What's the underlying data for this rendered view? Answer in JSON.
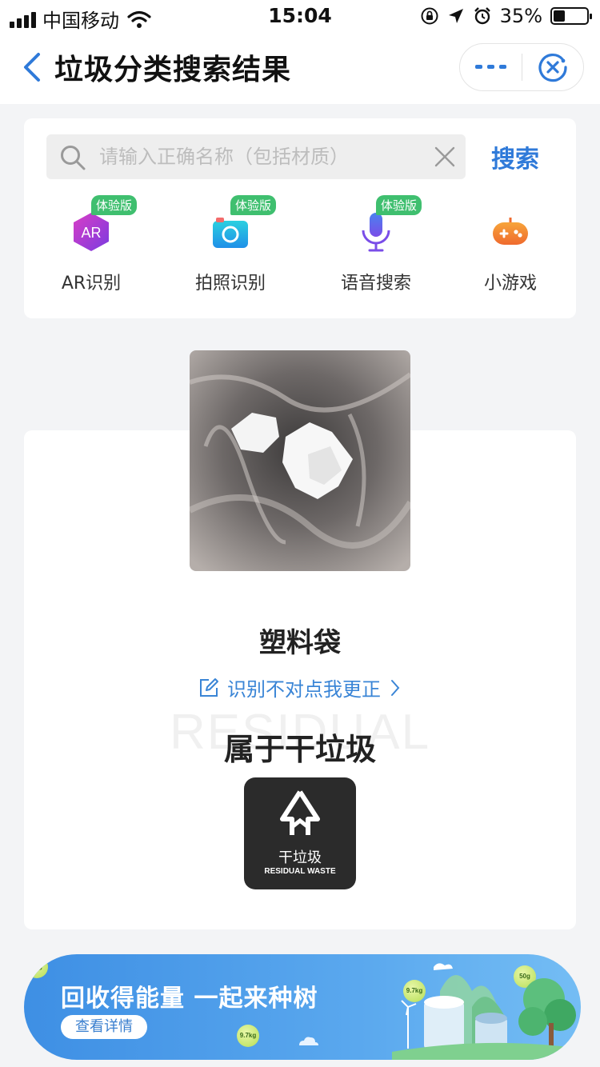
{
  "status_bar": {
    "carrier": "中国移动",
    "time": "15:04",
    "battery_percent": "35%",
    "battery_level": 0.35
  },
  "nav": {
    "title": "垃圾分类搜索结果"
  },
  "search": {
    "placeholder": "请输入正确名称（包括材质）",
    "value": "",
    "button_label": "搜索"
  },
  "features": [
    {
      "label": "AR识别",
      "badge": "体验版",
      "icon": "ar-icon"
    },
    {
      "label": "拍照识别",
      "badge": "体验版",
      "icon": "camera-icon"
    },
    {
      "label": "语音搜索",
      "badge": "体验版",
      "icon": "microphone-icon"
    },
    {
      "label": "小游戏",
      "badge": "",
      "icon": "gamepad-icon"
    }
  ],
  "result": {
    "item_name": "塑料袋",
    "correction_link": "识别不对点我更正",
    "watermark": "RESIDUAL",
    "category_label": "属于干垃圾",
    "category_icon_cn": "干垃圾",
    "category_icon_en": "RESIDUAL WASTE"
  },
  "banner": {
    "title": "回收得能量 一起来种树",
    "button_label": "查看详情",
    "coins": [
      "50g",
      "9.7kg",
      "50g",
      "9.7kg"
    ]
  },
  "colors": {
    "accent": "#2f7ad9",
    "badge_green": "#3fbf6f",
    "category_dark": "#2b2b2b"
  }
}
